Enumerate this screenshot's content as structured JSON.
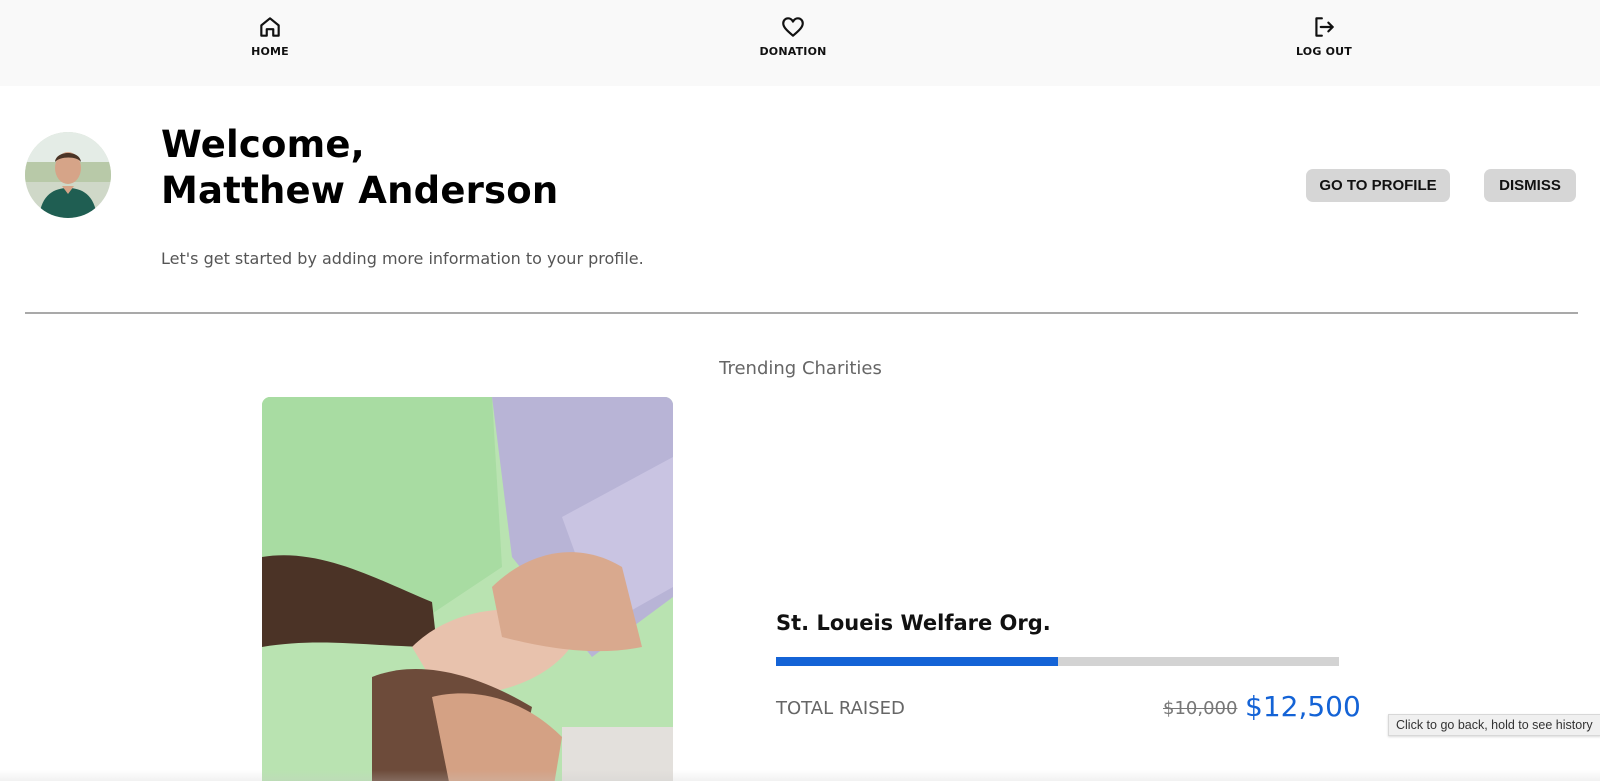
{
  "nav": {
    "items": [
      {
        "label": "HOME",
        "icon": "home-icon"
      },
      {
        "label": "DONATION",
        "icon": "heart-icon"
      },
      {
        "label": "LOG OUT",
        "icon": "logout-icon"
      }
    ]
  },
  "welcome": {
    "greeting": "Welcome,",
    "name": "Matthew Anderson",
    "subtitle": "Let's get started by adding more information to your profile.",
    "profile_button": "GO TO PROFILE",
    "dismiss_button": "DISMISS"
  },
  "trending": {
    "title": "Trending Charities",
    "charity": {
      "name": "St. Loueis Welfare Org.",
      "progress_fraction": 0.5,
      "raised_label": "TOTAL RAISED",
      "goal": "$10,000",
      "raised": "$12,500"
    }
  },
  "tooltip": "Click to go back, hold to see history",
  "colors": {
    "accent": "#1463d6",
    "nav_bg": "#f9f9f9",
    "button_bg": "#d6d6d6",
    "track": "#d3d3d3"
  }
}
